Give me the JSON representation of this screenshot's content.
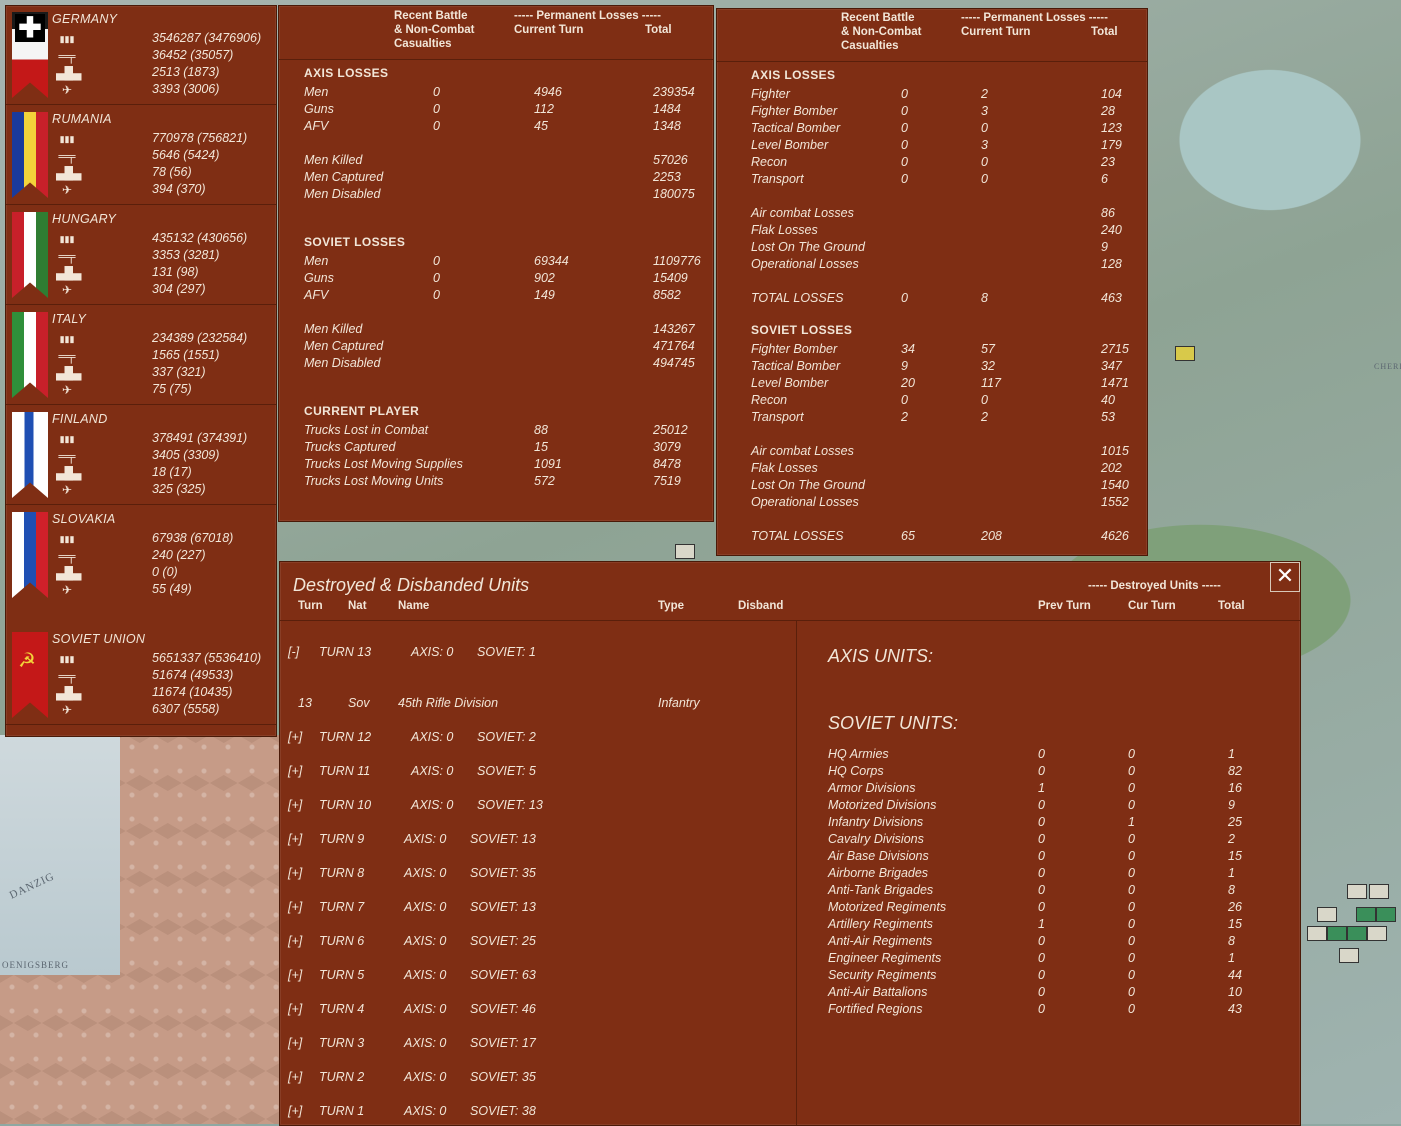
{
  "nations": [
    {
      "name": "GERMANY",
      "men": "3546287 (3476906)",
      "guns": "36452 (35057)",
      "afv": "2513 (1873)",
      "air": "3393 (3006)",
      "colors": [
        "#000000",
        "#ffffff",
        "#cc0000"
      ]
    },
    {
      "name": "RUMANIA",
      "men": "770978 (756821)",
      "guns": "5646 (5424)",
      "afv": "78 (56)",
      "air": "394 (370)",
      "colors": [
        "#1a3a9c",
        "#f3d33a",
        "#c8202a"
      ]
    },
    {
      "name": "HUNGARY",
      "men": "435132 (430656)",
      "guns": "3353 (3281)",
      "afv": "131 (98)",
      "air": "304 (297)",
      "colors": [
        "#c8202a",
        "#ffffff",
        "#2f7d32"
      ]
    },
    {
      "name": "ITALY",
      "men": "234389 (232584)",
      "guns": "1565 (1551)",
      "afv": "337 (321)",
      "air": "75 (75)",
      "colors": [
        "#2f8f3a",
        "#ffffff",
        "#c8202a"
      ]
    },
    {
      "name": "FINLAND",
      "men": "378491 (374391)",
      "guns": "3405 (3309)",
      "afv": "18 (17)",
      "air": "325 (325)",
      "colors": [
        "#ffffff",
        "#1f4fb3",
        "#ffffff"
      ]
    },
    {
      "name": "SLOVAKIA",
      "men": "67938 (67018)",
      "guns": "240 (227)",
      "afv": "0 (0)",
      "air": "55 (49)",
      "colors": [
        "#ffffff",
        "#1f4fb3",
        "#d0202a"
      ]
    },
    {
      "name": "SOVIET UNION",
      "men": "5651337 (5536410)",
      "guns": "51674 (49533)",
      "afv": "11674 (10435)",
      "air": "6307 (5558)",
      "colors": [
        "#cc1a1a",
        "#cc1a1a",
        "#cc1a1a"
      ]
    }
  ],
  "ground": {
    "hdr_recent": "Recent Battle\n& Non-Combat\nCasualties",
    "hdr_perm": "----- Permanent Losses -----",
    "hdr_cur": "Current Turn",
    "hdr_total": "Total",
    "axis_title": "AXIS LOSSES",
    "axis_rows": [
      [
        "Men",
        "0",
        "4946",
        "239354"
      ],
      [
        "Guns",
        "0",
        "112",
        "1484"
      ],
      [
        "AFV",
        "0",
        "45",
        "1348"
      ]
    ],
    "axis_extra": [
      [
        "Men Killed",
        "57026"
      ],
      [
        "Men Captured",
        "2253"
      ],
      [
        "Men Disabled",
        "180075"
      ]
    ],
    "soviet_title": "SOVIET LOSSES",
    "soviet_rows": [
      [
        "Men",
        "0",
        "69344",
        "1109776"
      ],
      [
        "Guns",
        "0",
        "902",
        "15409"
      ],
      [
        "AFV",
        "0",
        "149",
        "8582"
      ]
    ],
    "soviet_extra": [
      [
        "Men Killed",
        "143267"
      ],
      [
        "Men Captured",
        "471764"
      ],
      [
        "Men Disabled",
        "494745"
      ]
    ],
    "player_title": "CURRENT PLAYER",
    "player_rows": [
      [
        "Trucks Lost in Combat",
        "88",
        "25012"
      ],
      [
        "Trucks Captured",
        "15",
        "3079"
      ],
      [
        "Trucks Lost Moving Supplies",
        "1091",
        "8478"
      ],
      [
        "Trucks Lost Moving Units",
        "572",
        "7519"
      ]
    ]
  },
  "air": {
    "hdr_recent": "Recent Battle\n& Non-Combat\nCasualties",
    "hdr_perm": "----- Permanent Losses -----",
    "hdr_cur": "Current Turn",
    "hdr_total": "Total",
    "axis_title": "AXIS LOSSES",
    "axis_rows": [
      [
        "Fighter",
        "0",
        "2",
        "104"
      ],
      [
        "Fighter Bomber",
        "0",
        "3",
        "28"
      ],
      [
        "Tactical Bomber",
        "0",
        "0",
        "123"
      ],
      [
        "Level Bomber",
        "0",
        "3",
        "179"
      ],
      [
        "Recon",
        "0",
        "0",
        "23"
      ],
      [
        "Transport",
        "0",
        "0",
        "6"
      ]
    ],
    "axis_extra": [
      [
        "Air combat Losses",
        "86"
      ],
      [
        "Flak Losses",
        "240"
      ],
      [
        "Lost On The Ground",
        "9"
      ],
      [
        "Operational Losses",
        "128"
      ]
    ],
    "axis_total": [
      "TOTAL LOSSES",
      "0",
      "8",
      "463"
    ],
    "soviet_title": "SOVIET LOSSES",
    "soviet_rows": [
      [
        "Fighter Bomber",
        "34",
        "57",
        "2715"
      ],
      [
        "Tactical Bomber",
        "9",
        "32",
        "347"
      ],
      [
        "Level Bomber",
        "20",
        "117",
        "1471"
      ],
      [
        "Recon",
        "0",
        "0",
        "40"
      ],
      [
        "Transport",
        "2",
        "2",
        "53"
      ]
    ],
    "soviet_extra": [
      [
        "Air combat Losses",
        "1015"
      ],
      [
        "Flak Losses",
        "202"
      ],
      [
        "Lost On The Ground",
        "1540"
      ],
      [
        "Operational Losses",
        "1552"
      ]
    ],
    "soviet_total": [
      "TOTAL LOSSES",
      "65",
      "208",
      "4626"
    ]
  },
  "dest": {
    "title": "Destroyed & Disbanded Units",
    "close_label": "✕",
    "hdr_destroyed": "----- Destroyed Units -----",
    "cols": [
      "Turn",
      "Nat",
      "Name",
      "Type",
      "Disband",
      "Prev Turn",
      "Cur Turn",
      "Total"
    ],
    "turns": [
      {
        "toggle": "[-]",
        "turn": "TURN 13",
        "axis": "AXIS: 0",
        "soviet": "SOVIET: 1"
      },
      {
        "toggle": "[+]",
        "turn": "TURN 12",
        "axis": "AXIS: 0",
        "soviet": "SOVIET: 2"
      },
      {
        "toggle": "[+]",
        "turn": "TURN 11",
        "axis": "AXIS: 0",
        "soviet": "SOVIET: 5"
      },
      {
        "toggle": "[+]",
        "turn": "TURN 10",
        "axis": "AXIS: 0",
        "soviet": "SOVIET: 13"
      },
      {
        "toggle": "[+]",
        "turn": "TURN 9",
        "axis": "AXIS: 0",
        "soviet": "SOVIET: 13"
      },
      {
        "toggle": "[+]",
        "turn": "TURN 8",
        "axis": "AXIS: 0",
        "soviet": "SOVIET: 35"
      },
      {
        "toggle": "[+]",
        "turn": "TURN 7",
        "axis": "AXIS: 0",
        "soviet": "SOVIET: 13"
      },
      {
        "toggle": "[+]",
        "turn": "TURN 6",
        "axis": "AXIS: 0",
        "soviet": "SOVIET: 25"
      },
      {
        "toggle": "[+]",
        "turn": "TURN 5",
        "axis": "AXIS: 0",
        "soviet": "SOVIET: 63"
      },
      {
        "toggle": "[+]",
        "turn": "TURN 4",
        "axis": "AXIS: 0",
        "soviet": "SOVIET: 46"
      },
      {
        "toggle": "[+]",
        "turn": "TURN 3",
        "axis": "AXIS: 0",
        "soviet": "SOVIET: 17"
      },
      {
        "toggle": "[+]",
        "turn": "TURN 2",
        "axis": "AXIS: 0",
        "soviet": "SOVIET: 35"
      },
      {
        "toggle": "[+]",
        "turn": "TURN 1",
        "axis": "AXIS: 0",
        "soviet": "SOVIET: 38"
      }
    ],
    "unit_row": {
      "turn": "13",
      "nat": "Sov",
      "name": "45th Rifle Division",
      "type": "Infantry"
    },
    "axis_units_title": "AXIS UNITS:",
    "soviet_units_title": "SOVIET UNITS:",
    "soviet_units": [
      [
        "HQ Armies",
        "0",
        "0",
        "1"
      ],
      [
        "HQ Corps",
        "0",
        "0",
        "82"
      ],
      [
        "Armor Divisions",
        "1",
        "0",
        "16"
      ],
      [
        "Motorized Divisions",
        "0",
        "0",
        "9"
      ],
      [
        "Infantry Divisions",
        "0",
        "1",
        "25"
      ],
      [
        "Cavalry Divisions",
        "0",
        "0",
        "2"
      ],
      [
        "Air Base Divisions",
        "0",
        "0",
        "15"
      ],
      [
        "Airborne Brigades",
        "0",
        "0",
        "1"
      ],
      [
        "Anti-Tank Brigades",
        "0",
        "0",
        "8"
      ],
      [
        "Motorized Regiments",
        "0",
        "0",
        "26"
      ],
      [
        "Artillery Regiments",
        "1",
        "0",
        "15"
      ],
      [
        "Anti-Air Regiments",
        "0",
        "0",
        "8"
      ],
      [
        "Engineer Regiments",
        "0",
        "0",
        "1"
      ],
      [
        "Security Regiments",
        "0",
        "0",
        "44"
      ],
      [
        "Anti-Air Battalions",
        "0",
        "0",
        "10"
      ],
      [
        "Fortified Regions",
        "0",
        "0",
        "43"
      ]
    ]
  },
  "map": {
    "label_danzig": "DANZIG",
    "label_koenigsberg": "OENIGSBERG",
    "label_cherep": "CHERE"
  }
}
